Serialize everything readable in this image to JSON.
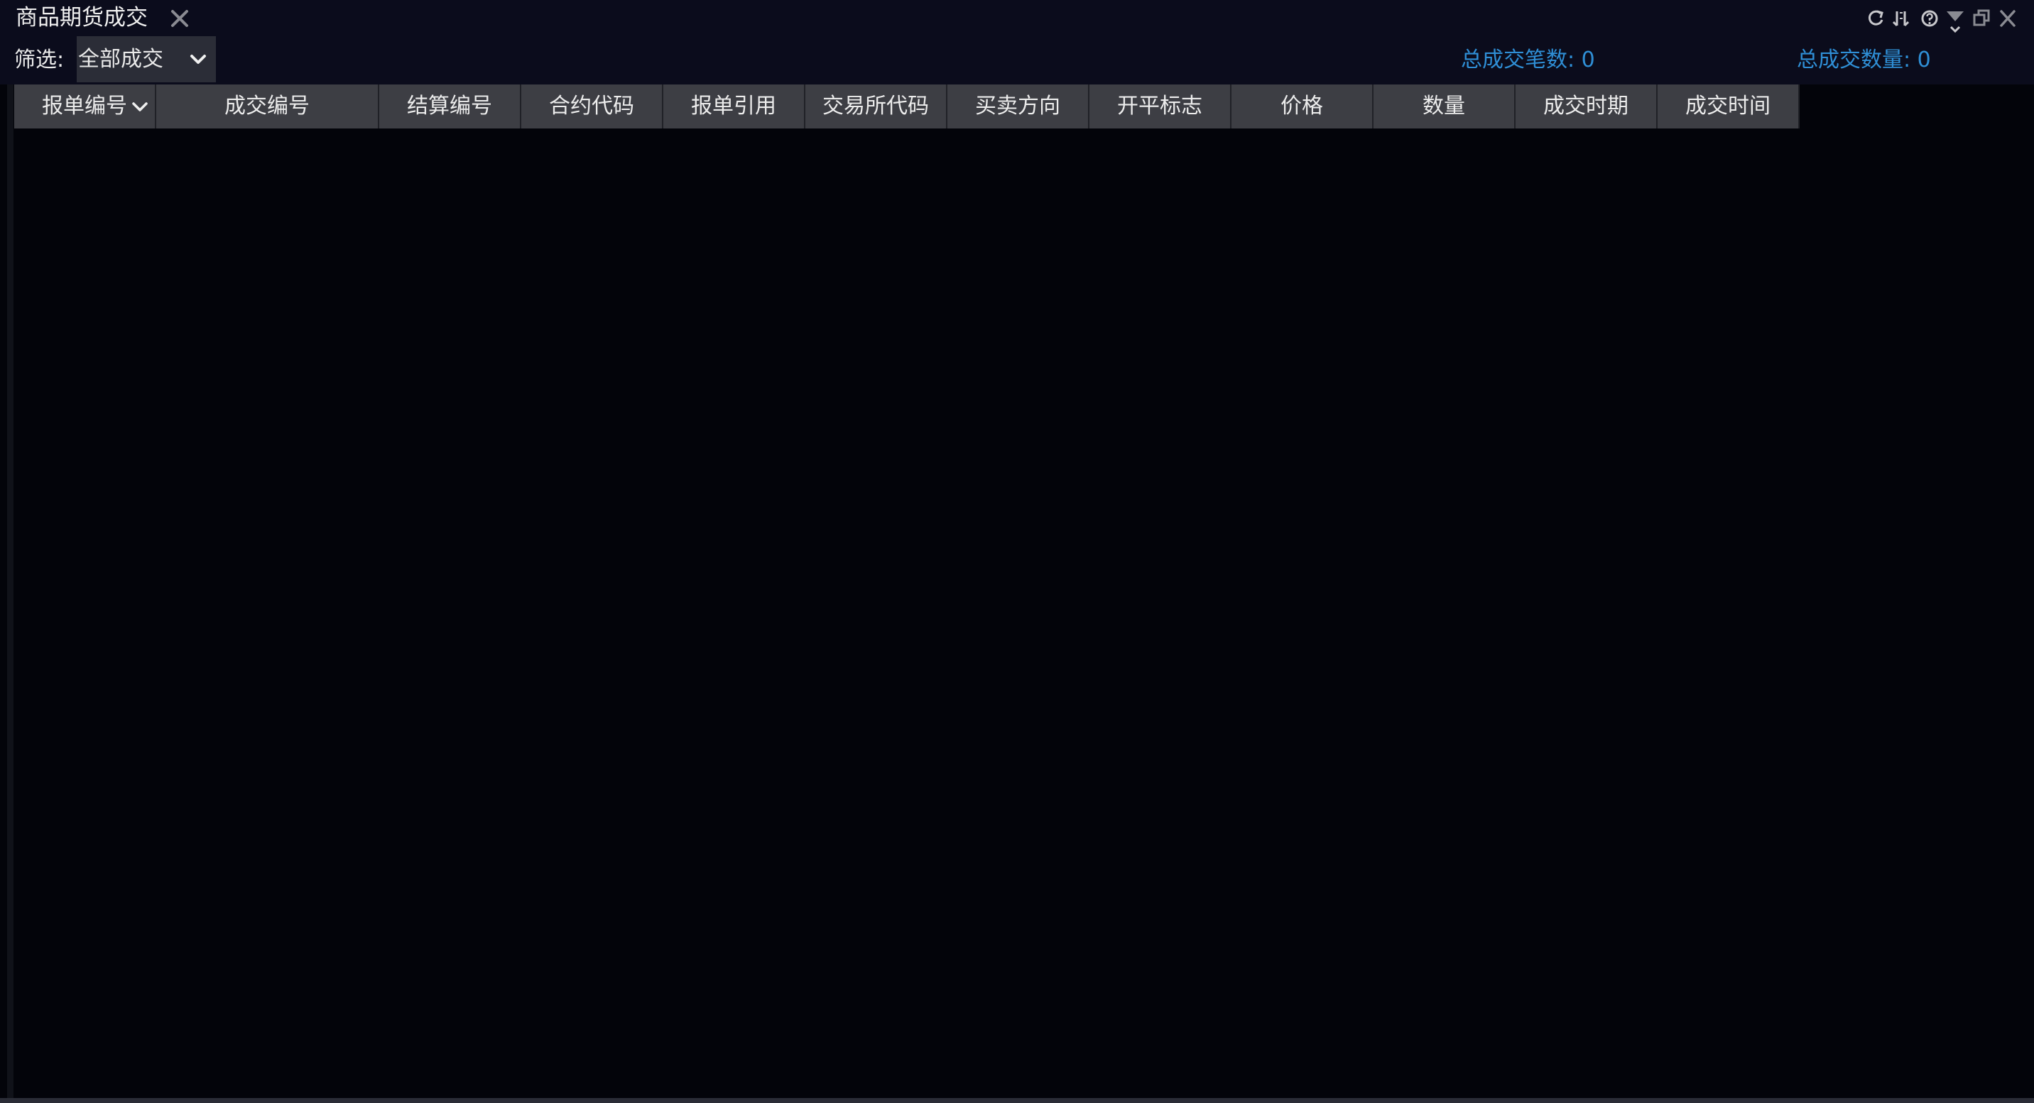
{
  "window": {
    "tab_title": "商品期货成交",
    "controls": [
      "refresh-icon",
      "sort-icon",
      "help-icon",
      "dropdown-icon",
      "restore-icon",
      "close-icon"
    ]
  },
  "toolbar": {
    "filter_label": "筛选:",
    "filter_value": "全部成交",
    "total_count_label": "总成交笔数: 0",
    "total_qty_label": "总成交数量: 0"
  },
  "table": {
    "columns": [
      "报单编号",
      "成交编号",
      "结算编号",
      "合约代码",
      "报单引用",
      "交易所代码",
      "买卖方向",
      "开平标志",
      "价格",
      "数量",
      "成交时期",
      "成交时间"
    ],
    "rows": []
  },
  "colors": {
    "background": "#03040a",
    "titlebar": "#0b0c1c",
    "header_cell": "#3d3e44",
    "accent_text": "#2f8fd6"
  }
}
